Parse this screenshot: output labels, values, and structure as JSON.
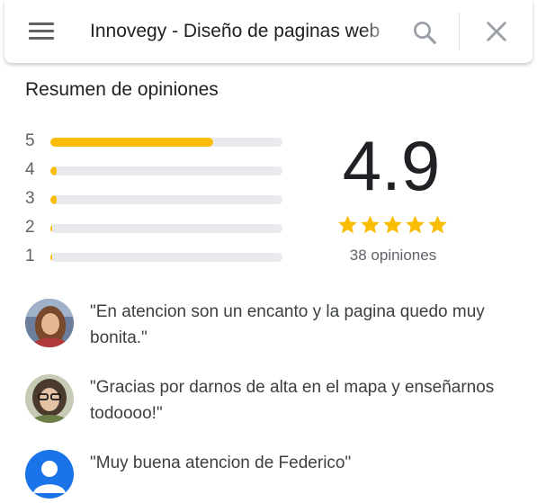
{
  "search": {
    "value": "Innovegy - Diseño de paginas web"
  },
  "summary": {
    "title": "Resumen de opiniones",
    "rating": "4.9",
    "stars": 5,
    "count_label": "38 opiniones",
    "distribution": [
      {
        "label": "5",
        "fraction": 0.7
      },
      {
        "label": "4",
        "fraction": 0.028
      },
      {
        "label": "3",
        "fraction": 0.028
      },
      {
        "label": "2",
        "fraction": 0.008
      },
      {
        "label": "1",
        "fraction": 0.008
      }
    ]
  },
  "colors": {
    "star": "#fbbc04",
    "track": "#e8eaed"
  },
  "reviews": [
    {
      "text": "\"En atencion son un encanto y la pagina quedo muy bonita.\"",
      "avatar": "photo-avatar"
    },
    {
      "text": "\"Gracias por darnos de alta en el mapa y enseñarnos todoooo!\"",
      "avatar": "photo-avatar"
    },
    {
      "text": "\"Muy buena atencion de Federico\"",
      "avatar": "default-user-avatar"
    }
  ]
}
